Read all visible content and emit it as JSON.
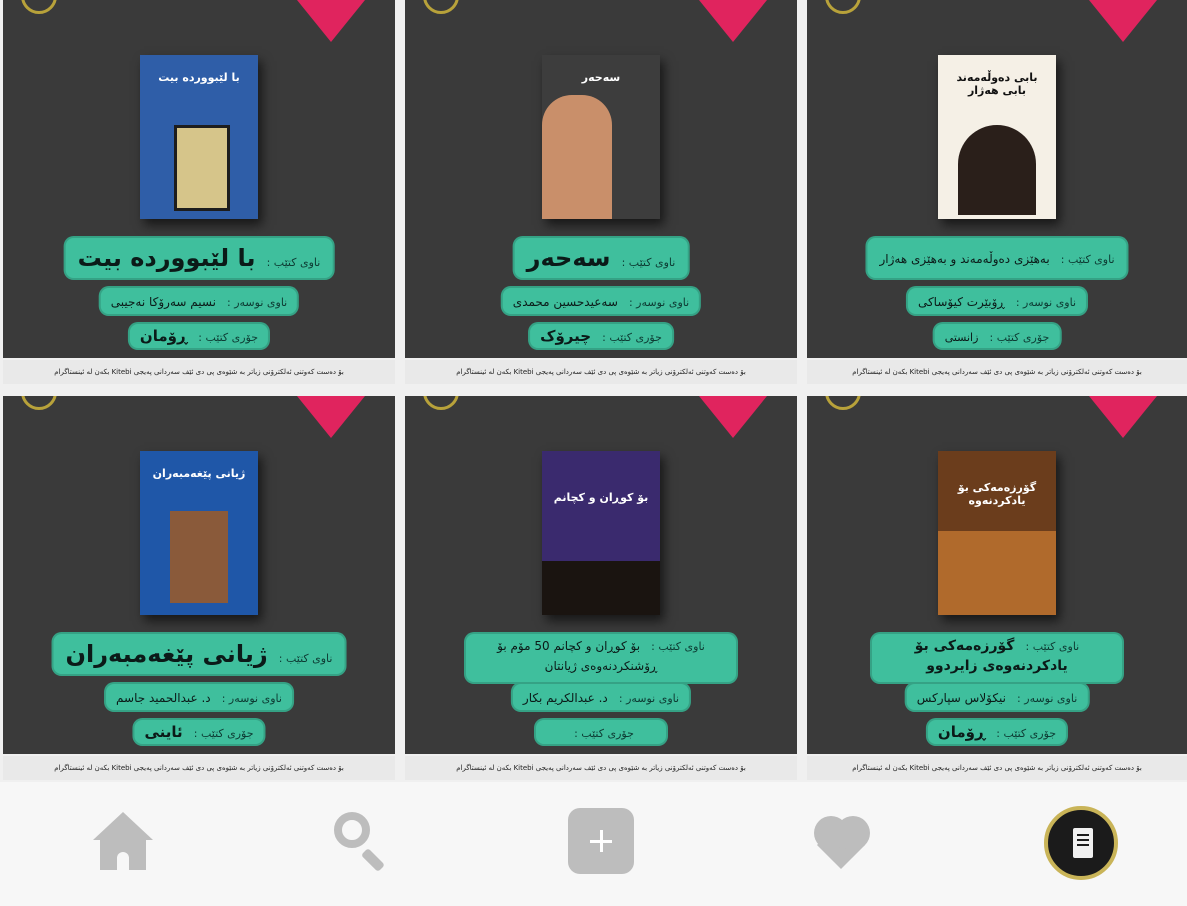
{
  "posts": [
    {
      "title_label": "ناوی کتێب :",
      "title": "با لێبوورده بیت",
      "author_label": "ناوی نوسەر :",
      "author": "نسیم سەرۆکا نەجیبی",
      "genre_label": "جۆری کتێب :",
      "genre": "ڕۆمان",
      "cover_text": "با لێبوورده بیت",
      "cover_color": "#2f5ea8",
      "caption": "بۆ دەست کەوتنی ئەلکترۆنی زیاتر بە شێوەی پی دی ئێف سەردانی پەیجی Kitebi بکەن لە ئینستاگرام"
    },
    {
      "title_label": "ناوی کتێب :",
      "title": "سەحەر",
      "author_label": "ناوی نوسەر :",
      "author": "سەعیدحسین محمدی",
      "genre_label": "جۆری کتێب :",
      "genre": "چیرۆک",
      "cover_text": "سەحەر",
      "cover_color": "#3d3d3d",
      "caption": "بۆ دەست کەوتنی ئەلکترۆنی زیاتر بە شێوەی پی دی ئێف سەردانی پەیجی Kitebi بکەن لە ئینستاگرام"
    },
    {
      "title_label": "ناوی کتێب :",
      "title": "بەهێزی دەوڵەمەند و بەهێزی هەژار",
      "author_label": "ناوی نوسەر :",
      "author": "ڕۆبێرت کیۆساکی",
      "genre_label": "جۆری کتێب :",
      "genre": "زانستی",
      "cover_text": "بابی دەوڵەمەند بابی هەژار",
      "cover_color": "#f5f0e6",
      "caption": "بۆ دەست کەوتنی ئەلکترۆنی زیاتر بە شێوەی پی دی ئێف سەردانی پەیجی Kitebi بکەن لە ئینستاگرام"
    },
    {
      "title_label": "ناوی کتێب :",
      "title": "ژیانی پێغەمبەران",
      "author_label": "ناوی نوسەر :",
      "author": "د. عبدالحمید جاسم",
      "genre_label": "جۆری کتێب :",
      "genre": "ئاینی",
      "cover_text": "ژیانی پێغەمبەران",
      "cover_color": "#1f57a8",
      "caption": "بۆ دەست کەوتنی ئەلکترۆنی زیاتر بە شێوەی پی دی ئێف سەردانی پەیجی Kitebi بکەن لە ئینستاگرام"
    },
    {
      "title_label": "ناوی کتێب :",
      "title": "بۆ کوڕان و کچانم 50 مۆم بۆ ڕۆشنکردنەوەی ژیانتان",
      "author_label": "ناوی نوسەر :",
      "author": "د. عبدالکریم بکار",
      "genre_label": "جۆری کتێب :",
      "genre": "",
      "cover_text": "بۆ کوڕان و کچانم",
      "cover_color": "#3a2a6e",
      "caption": "بۆ دەست کەوتنی ئەلکترۆنی زیاتر بە شێوەی پی دی ئێف سەردانی پەیجی Kitebi بکەن لە ئینستاگرام"
    },
    {
      "title_label": "ناوی کتێب :",
      "title": "گۆرزەمەکی بۆ یادکردنەوەی زایردوو",
      "author_label": "ناوی نوسەر :",
      "author": "نیکۆلاس سپارکس",
      "genre_label": "جۆری کتێب :",
      "genre": "ڕۆمان",
      "cover_text": "گۆرزەمەکی بۆ یادکردنەوە",
      "cover_color": "#6b3d1c",
      "caption": "بۆ دەست کەوتنی ئەلکترۆنی زیاتر بە شێوەی پی دی ئێف سەردانی پەیجی Kitebi بکەن لە ئینستاگرام"
    }
  ],
  "colors": {
    "tile_bg": "#3a3a3a",
    "pill": "#3fbf9d",
    "corner": "#e0245e",
    "nav_icon": "#bdbdbd"
  },
  "nav": {
    "icons": [
      "home-icon",
      "search-icon",
      "add-icon",
      "heart-icon",
      "profile-icon"
    ]
  }
}
